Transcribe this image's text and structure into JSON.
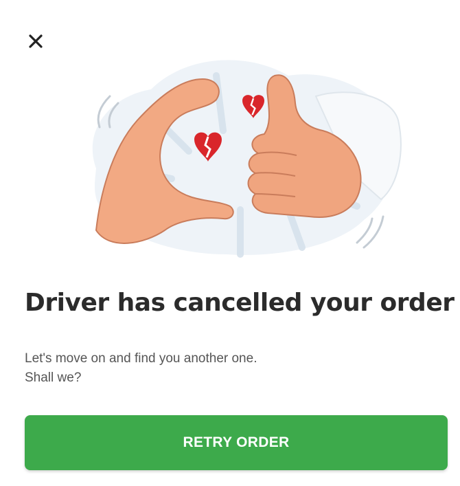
{
  "dialog": {
    "close_icon": "close-icon",
    "illustration_icon": "heartbreak-hands-illustration",
    "title": "Driver has cancelled your order",
    "subtitle_line1": "Let's move on and find you another one.",
    "subtitle_line2": "Shall we?",
    "retry_label": "RETRY ORDER"
  },
  "colors": {
    "accent_green": "#3daa4b",
    "heart_red": "#d9262b",
    "skin": "#f2a983",
    "title_text": "#2b2b2b"
  }
}
